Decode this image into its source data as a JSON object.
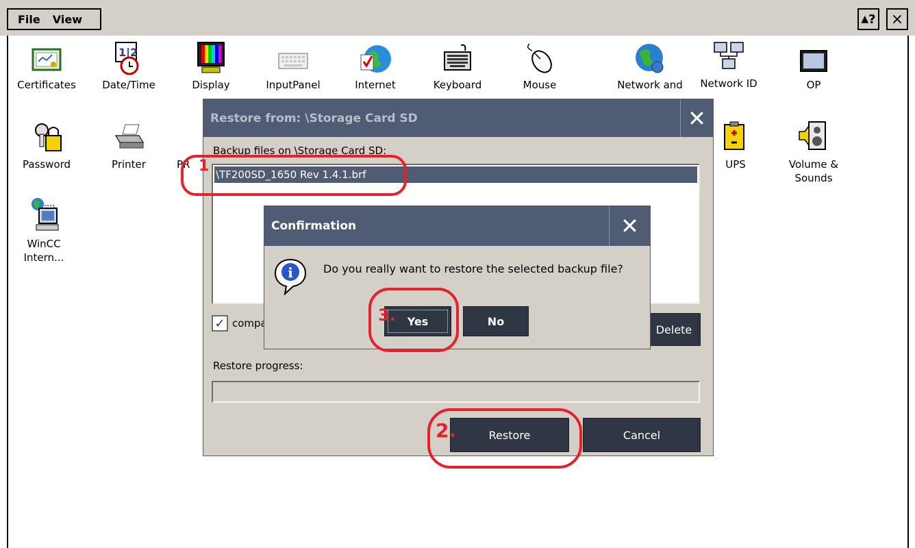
{
  "menubar": {
    "menus": [
      "File",
      "View"
    ],
    "help_label": "?",
    "close_label": "×"
  },
  "icons": [
    {
      "label": "Certificates",
      "icon": "certificate-icon"
    },
    {
      "label": "Date/Time",
      "icon": "calendar-clock-icon"
    },
    {
      "label": "Display",
      "icon": "display-icon"
    },
    {
      "label": "InputPanel",
      "icon": "input-panel-icon"
    },
    {
      "label": "Internet",
      "icon": "internet-globe-icon"
    },
    {
      "label": "Keyboard",
      "icon": "keyboard-icon"
    },
    {
      "label": "Mouse",
      "icon": "mouse-icon"
    },
    {
      "label": "Network and",
      "icon": "network-globe-icon"
    },
    {
      "label": "Network ID",
      "icon": "network-id-icon"
    },
    {
      "label": "OP",
      "icon": "op-monitor-icon"
    },
    {
      "label": "Password",
      "icon": "password-keys-icon"
    },
    {
      "label": "Printer",
      "icon": "printer-icon"
    },
    {
      "label": "PR",
      "icon": "profinet-icon"
    },
    {
      "label": "UPS",
      "icon": "ups-battery-icon"
    },
    {
      "label": "Volume &\nSounds",
      "icon": "volume-sounds-icon"
    },
    {
      "label": "WinCC\nIntern...",
      "icon": "wincc-internet-icon"
    }
  ],
  "restore_dialog": {
    "title": "Restore from: \\Storage Card SD",
    "close_label": "✕",
    "list_label": "Backup files on \\Storage Card SD:",
    "selected_file": "\\TF200SD_1650 Rev 1.4.1.brf",
    "compat_label": "compa",
    "compat_checked": "✓",
    "delete_label": "Delete",
    "progress_label": "Restore progress:",
    "progress_value": 0,
    "restore_label": "Restore",
    "cancel_label": "Cancel"
  },
  "confirm_dialog": {
    "title": "Confirmation",
    "close_label": "✕",
    "message": "Do you really want to restore the selected backup file?",
    "yes_label": "Yes",
    "no_label": "No"
  },
  "annotations": {
    "step1": "1",
    "step2": "2.",
    "step3": "3."
  },
  "colors": {
    "titlebar": "#4f5c74",
    "dark_button": "#2f3644",
    "annotation": "#e8202a",
    "menubar": "#d4d0c8"
  }
}
